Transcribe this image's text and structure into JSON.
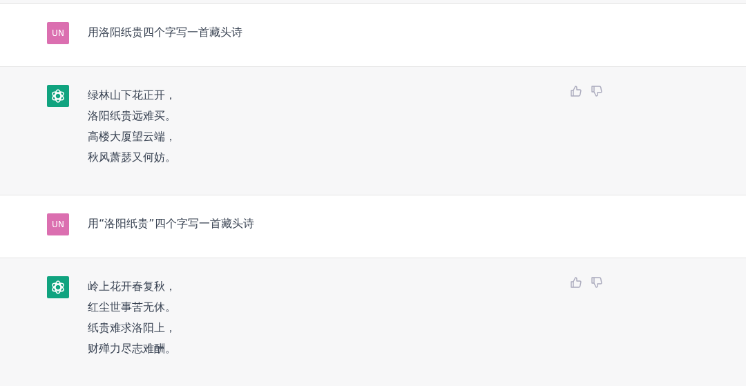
{
  "messages": [
    {
      "kind": "user",
      "avatar": "UN",
      "lines": [
        "用洛阳纸贵四个字写一首藏头诗"
      ]
    },
    {
      "kind": "assistant",
      "lines": [
        "绿林山下花正开，",
        "洛阳纸贵远难买。",
        "高楼大厦望云端，",
        "秋风萧瑟又何妨。"
      ]
    },
    {
      "kind": "user",
      "avatar": "UN",
      "lines": [
        "用“洛阳纸贵”四个字写一首藏头诗"
      ]
    },
    {
      "kind": "assistant",
      "lines": [
        "岭上花开春复秋，",
        "红尘世事苦无休。",
        "纸贵难求洛阳上，",
        "财殚力尽志难酬。"
      ]
    }
  ]
}
